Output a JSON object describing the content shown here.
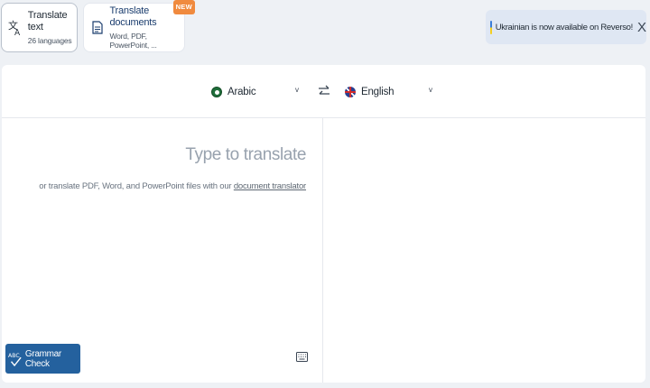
{
  "tabs": [
    {
      "title": "Translate text",
      "subtitle": "26 languages",
      "active": true,
      "icon": "translate-icon"
    },
    {
      "title": "Translate documents",
      "subtitle": "Word, PDF, PowerPoint, ...",
      "badge": "NEW",
      "active": false,
      "icon": "document-icon"
    }
  ],
  "notice": {
    "text": "Ukrainian is now available on Reverso!",
    "close_label": "X",
    "icon": "ukraine-flag-icon"
  },
  "language_bar": {
    "source_language": "Arabic",
    "target_language": "English",
    "source_flag": "arabic-flag-icon",
    "target_flag": "uk-flag-icon",
    "swap_icon": "swap-arrows-icon",
    "chevron": "v"
  },
  "source": {
    "placeholder": "Type to translate",
    "hint_prefix": "or translate PDF, Word, and PowerPoint files with our ",
    "hint_link": "document translator"
  },
  "grammar_button": {
    "label": "Grammar Check",
    "icon": "abc-check-icon"
  },
  "keyboard_icon": "keyboard-icon",
  "colors": {
    "accent": "#24619e",
    "badge": "#f08a3e",
    "notice_bg": "#dfe7f3",
    "page_bg": "#eef1f5"
  }
}
